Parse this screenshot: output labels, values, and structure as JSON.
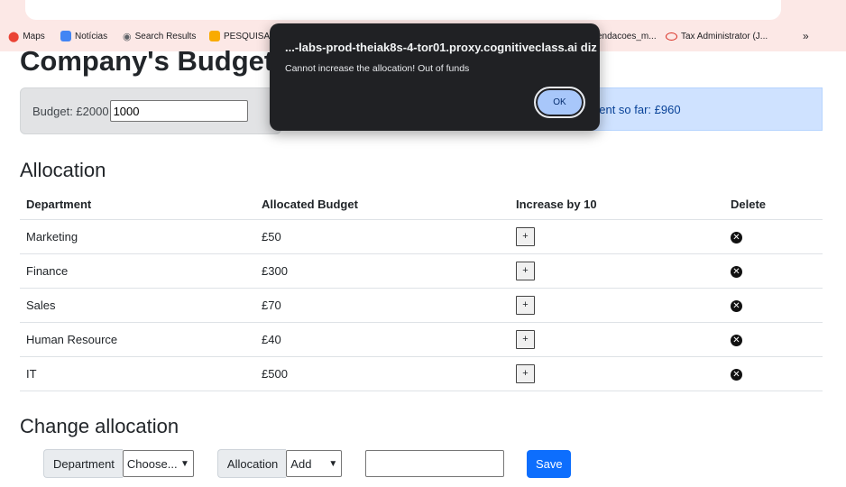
{
  "bookmarks": [
    {
      "label": "Maps",
      "icon": "maps-pin-icon",
      "color": "#ea4335"
    },
    {
      "label": "Notícias",
      "icon": "news-icon",
      "color": "#4285f4"
    },
    {
      "label": "Search Results",
      "icon": "search-results-icon",
      "color": "#5f6368"
    },
    {
      "label": "PESQUISA D",
      "icon": "spreadsheet-icon",
      "color": "#f9ab00"
    },
    {
      "label": "endacoes_m...",
      "icon": "",
      "color": ""
    },
    {
      "label": "Tax Administrator (J...",
      "icon": "oval-icon",
      "color": "#d93025"
    }
  ],
  "bookmarks_more": "»",
  "page": {
    "title": "Company's Budget",
    "budget_label": "Budget: £2000",
    "budget_value": "1000",
    "spent_label": "pent so far: £960"
  },
  "allocation": {
    "heading": "Allocation",
    "columns": [
      "Department",
      "Allocated Budget",
      "Increase by 10",
      "Delete"
    ],
    "rows": [
      {
        "department": "Marketing",
        "budget": "£50",
        "increase": "+",
        "delete": "✕"
      },
      {
        "department": "Finance",
        "budget": "£300",
        "increase": "+",
        "delete": "✕"
      },
      {
        "department": "Sales",
        "budget": "£70",
        "increase": "+",
        "delete": "✕"
      },
      {
        "department": "Human Resource",
        "budget": "£40",
        "increase": "+",
        "delete": "✕"
      },
      {
        "department": "IT",
        "budget": "£500",
        "increase": "+",
        "delete": "✕"
      }
    ]
  },
  "change": {
    "heading": "Change allocation",
    "department_label": "Department",
    "department_select": "Choose...",
    "allocation_label": "Allocation",
    "allocation_select": "Add",
    "amount_value": "",
    "save_label": "Save"
  },
  "dialog": {
    "title": "...-labs-prod-theiak8s-4-tor01.proxy.cognitiveclass.ai diz",
    "message": "Cannot increase the allocation! Out of funds",
    "ok_label": "OK"
  },
  "colors": {
    "accent": "#0d6efd",
    "info_bg": "#cfe2ff",
    "dialog_bg": "#202124"
  }
}
